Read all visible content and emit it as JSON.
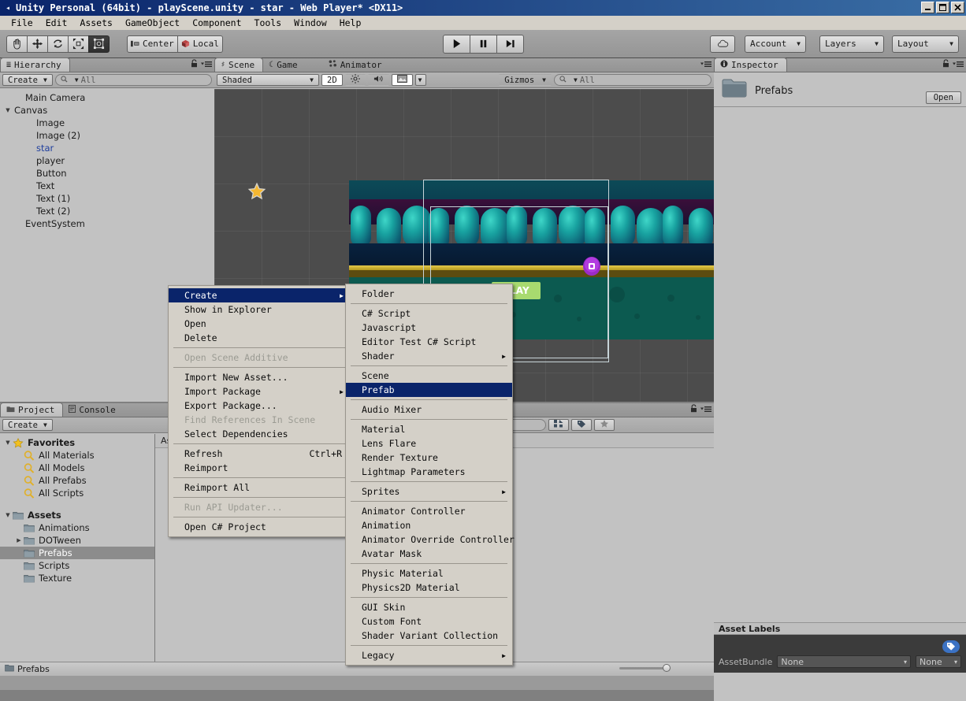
{
  "window": {
    "title": "Unity Personal (64bit) - playScene.unity - star - Web Player* <DX11>",
    "minimize": "_",
    "maximize": "□",
    "close": "×"
  },
  "menubar": {
    "items": [
      "File",
      "Edit",
      "Assets",
      "GameObject",
      "Component",
      "Tools",
      "Window",
      "Help"
    ]
  },
  "toolbar": {
    "tools": [
      {
        "name": "hand-tool",
        "glyph": "✋",
        "selected": false
      },
      {
        "name": "move-tool",
        "glyph": "✥",
        "selected": false
      },
      {
        "name": "rotate-tool",
        "glyph": "⟳",
        "selected": false
      },
      {
        "name": "scale-tool",
        "glyph": "⤡",
        "selected": false
      },
      {
        "name": "rect-tool",
        "glyph": "▣",
        "selected": true
      }
    ],
    "pivot_label": "Center",
    "space_label": "Local",
    "play_label": "▶",
    "pause_label": "❙❙",
    "step_label": "▶❙",
    "cloud_label": "",
    "account_label": "Account",
    "layers_label": "Layers",
    "layout_label": "Layout"
  },
  "hierarchy": {
    "tab_label": "Hierarchy",
    "create_label": "Create",
    "search_placeholder": "All",
    "items": [
      {
        "label": "Main Camera",
        "indent": 1,
        "arrow": "",
        "style": "normal"
      },
      {
        "label": "Canvas",
        "indent": 0,
        "arrow": "▼",
        "style": "normal"
      },
      {
        "label": "Image",
        "indent": 2,
        "arrow": "",
        "style": "normal"
      },
      {
        "label": "Image (2)",
        "indent": 2,
        "arrow": "",
        "style": "normal"
      },
      {
        "label": "star",
        "indent": 2,
        "arrow": "",
        "style": "blue"
      },
      {
        "label": "player",
        "indent": 2,
        "arrow": "",
        "style": "normal"
      },
      {
        "label": "Button",
        "indent": 2,
        "arrow": "",
        "style": "normal"
      },
      {
        "label": "Text",
        "indent": 2,
        "arrow": "",
        "style": "normal"
      },
      {
        "label": "Text (1)",
        "indent": 2,
        "arrow": "",
        "style": "normal"
      },
      {
        "label": "Text (2)",
        "indent": 2,
        "arrow": "",
        "style": "normal"
      },
      {
        "label": "EventSystem",
        "indent": 1,
        "arrow": "",
        "style": "normal"
      }
    ]
  },
  "sceneview": {
    "tabs": [
      {
        "label": "Scene",
        "icon": "grid-icon",
        "active": true
      },
      {
        "label": "Game",
        "icon": "moon-icon",
        "active": false
      },
      {
        "label": "Animator",
        "icon": "animator-icon",
        "active": false
      }
    ],
    "draw_mode": "Shaded",
    "two_d_label": "2D",
    "lighting_icon": "sun-icon",
    "audio_icon": "speaker-icon",
    "effects_icon": "image-icon",
    "gizmos_label": "Gizmos",
    "search_placeholder": "All",
    "game_button_label": "PLAY"
  },
  "inspector": {
    "tab_label": "Inspector",
    "asset_name": "Prefabs",
    "open_label": "Open",
    "asset_labels_header": "Asset Labels",
    "assetbundle_label": "AssetBundle",
    "assetbundle_value": "None",
    "variant_value": "None"
  },
  "project": {
    "tabs": [
      {
        "label": "Project",
        "icon": "folder-icon",
        "active": true
      },
      {
        "label": "Console",
        "icon": "console-icon",
        "active": false
      }
    ],
    "create_label": "Create",
    "search_placeholder": "",
    "assets_column_label": "Assets",
    "breadcrumb": "Prefabs",
    "tree": [
      {
        "label": "Favorites",
        "indent": 0,
        "arrow": "▼",
        "icon": "star-icon",
        "bold": true,
        "selected": false
      },
      {
        "label": "All Materials",
        "indent": 1,
        "arrow": "",
        "icon": "search-icon",
        "bold": false,
        "selected": false
      },
      {
        "label": "All Models",
        "indent": 1,
        "arrow": "",
        "icon": "search-icon",
        "bold": false,
        "selected": false
      },
      {
        "label": "All Prefabs",
        "indent": 1,
        "arrow": "",
        "icon": "search-icon",
        "bold": false,
        "selected": false
      },
      {
        "label": "All Scripts",
        "indent": 1,
        "arrow": "",
        "icon": "search-icon",
        "bold": false,
        "selected": false
      },
      {
        "label": "",
        "indent": 0,
        "arrow": "",
        "icon": "",
        "bold": false,
        "selected": false
      },
      {
        "label": "Assets",
        "indent": 0,
        "arrow": "▼",
        "icon": "folder-icon",
        "bold": true,
        "selected": false
      },
      {
        "label": "Animations",
        "indent": 1,
        "arrow": "",
        "icon": "folder-icon",
        "bold": false,
        "selected": false
      },
      {
        "label": "DOTween",
        "indent": 1,
        "arrow": "▶",
        "icon": "folder-icon",
        "bold": false,
        "selected": false
      },
      {
        "label": "Prefabs",
        "indent": 1,
        "arrow": "",
        "icon": "folder-icon",
        "bold": false,
        "selected": true
      },
      {
        "label": "Scripts",
        "indent": 1,
        "arrow": "",
        "icon": "folder-icon",
        "bold": false,
        "selected": false
      },
      {
        "label": "Texture",
        "indent": 1,
        "arrow": "",
        "icon": "folder-icon",
        "bold": false,
        "selected": false
      }
    ]
  },
  "context_menu": {
    "items": [
      {
        "label": "Create",
        "type": "item",
        "highlighted": true,
        "submenu": true,
        "disabled": false,
        "shortcut": ""
      },
      {
        "label": "Show in Explorer",
        "type": "item",
        "highlighted": false,
        "submenu": false,
        "disabled": false,
        "shortcut": ""
      },
      {
        "label": "Open",
        "type": "item",
        "highlighted": false,
        "submenu": false,
        "disabled": false,
        "shortcut": ""
      },
      {
        "label": "Delete",
        "type": "item",
        "highlighted": false,
        "submenu": false,
        "disabled": false,
        "shortcut": ""
      },
      {
        "type": "sep"
      },
      {
        "label": "Open Scene Additive",
        "type": "item",
        "highlighted": false,
        "submenu": false,
        "disabled": true,
        "shortcut": ""
      },
      {
        "type": "sep"
      },
      {
        "label": "Import New Asset...",
        "type": "item",
        "highlighted": false,
        "submenu": false,
        "disabled": false,
        "shortcut": ""
      },
      {
        "label": "Import Package",
        "type": "item",
        "highlighted": false,
        "submenu": true,
        "disabled": false,
        "shortcut": ""
      },
      {
        "label": "Export Package...",
        "type": "item",
        "highlighted": false,
        "submenu": false,
        "disabled": false,
        "shortcut": ""
      },
      {
        "label": "Find References In Scene",
        "type": "item",
        "highlighted": false,
        "submenu": false,
        "disabled": true,
        "shortcut": ""
      },
      {
        "label": "Select Dependencies",
        "type": "item",
        "highlighted": false,
        "submenu": false,
        "disabled": false,
        "shortcut": ""
      },
      {
        "type": "sep"
      },
      {
        "label": "Refresh",
        "type": "item",
        "highlighted": false,
        "submenu": false,
        "disabled": false,
        "shortcut": "Ctrl+R"
      },
      {
        "label": "Reimport",
        "type": "item",
        "highlighted": false,
        "submenu": false,
        "disabled": false,
        "shortcut": ""
      },
      {
        "type": "sep"
      },
      {
        "label": "Reimport All",
        "type": "item",
        "highlighted": false,
        "submenu": false,
        "disabled": false,
        "shortcut": ""
      },
      {
        "type": "sep"
      },
      {
        "label": "Run API Updater...",
        "type": "item",
        "highlighted": false,
        "submenu": false,
        "disabled": true,
        "shortcut": ""
      },
      {
        "type": "sep"
      },
      {
        "label": "Open C# Project",
        "type": "item",
        "highlighted": false,
        "submenu": false,
        "disabled": false,
        "shortcut": ""
      }
    ]
  },
  "create_submenu": {
    "items": [
      {
        "label": "Folder",
        "type": "item",
        "highlighted": false,
        "submenu": false
      },
      {
        "type": "sep"
      },
      {
        "label": "C# Script",
        "type": "item",
        "highlighted": false,
        "submenu": false
      },
      {
        "label": "Javascript",
        "type": "item",
        "highlighted": false,
        "submenu": false
      },
      {
        "label": "Editor Test C# Script",
        "type": "item",
        "highlighted": false,
        "submenu": false
      },
      {
        "label": "Shader",
        "type": "item",
        "highlighted": false,
        "submenu": true
      },
      {
        "type": "sep"
      },
      {
        "label": "Scene",
        "type": "item",
        "highlighted": false,
        "submenu": false
      },
      {
        "label": "Prefab",
        "type": "item",
        "highlighted": true,
        "submenu": false
      },
      {
        "type": "sep"
      },
      {
        "label": "Audio Mixer",
        "type": "item",
        "highlighted": false,
        "submenu": false
      },
      {
        "type": "sep"
      },
      {
        "label": "Material",
        "type": "item",
        "highlighted": false,
        "submenu": false
      },
      {
        "label": "Lens Flare",
        "type": "item",
        "highlighted": false,
        "submenu": false
      },
      {
        "label": "Render Texture",
        "type": "item",
        "highlighted": false,
        "submenu": false
      },
      {
        "label": "Lightmap Parameters",
        "type": "item",
        "highlighted": false,
        "submenu": false
      },
      {
        "type": "sep"
      },
      {
        "label": "Sprites",
        "type": "item",
        "highlighted": false,
        "submenu": true
      },
      {
        "type": "sep"
      },
      {
        "label": "Animator Controller",
        "type": "item",
        "highlighted": false,
        "submenu": false
      },
      {
        "label": "Animation",
        "type": "item",
        "highlighted": false,
        "submenu": false
      },
      {
        "label": "Animator Override Controller",
        "type": "item",
        "highlighted": false,
        "submenu": false
      },
      {
        "label": "Avatar Mask",
        "type": "item",
        "highlighted": false,
        "submenu": false
      },
      {
        "type": "sep"
      },
      {
        "label": "Physic Material",
        "type": "item",
        "highlighted": false,
        "submenu": false
      },
      {
        "label": "Physics2D Material",
        "type": "item",
        "highlighted": false,
        "submenu": false
      },
      {
        "type": "sep"
      },
      {
        "label": "GUI Skin",
        "type": "item",
        "highlighted": false,
        "submenu": false
      },
      {
        "label": "Custom Font",
        "type": "item",
        "highlighted": false,
        "submenu": false
      },
      {
        "label": "Shader Variant Collection",
        "type": "item",
        "highlighted": false,
        "submenu": false
      },
      {
        "type": "sep"
      },
      {
        "label": "Legacy",
        "type": "item",
        "highlighted": false,
        "submenu": true
      }
    ]
  },
  "colors": {
    "titlebar": "#0a246a",
    "menu_highlight": "#0a246a",
    "panel_bg": "#c2c2c2",
    "chrome": "#d4d0c8",
    "scene_bg": "#4c4c4c",
    "prefab_blue": "#1f3f9e"
  }
}
